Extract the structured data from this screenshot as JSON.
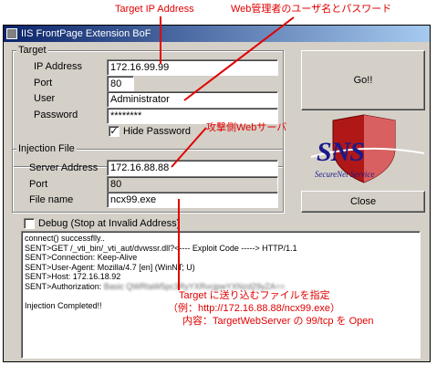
{
  "window": {
    "title": "IIS FrontPage Extension BoF"
  },
  "target_group": {
    "legend": "Target",
    "ip_label": "IP Address",
    "ip_value": "172.16.99.99",
    "port_label": "Port",
    "port_value": "80",
    "user_label": "User",
    "user_value": "Administrator",
    "password_label": "Password",
    "password_value": "********",
    "hide_password_label": "Hide Password",
    "hide_password_checked": "✓"
  },
  "injection_group": {
    "legend": "Injection File",
    "server_label": "Server Address",
    "server_value": "172.16.88.88",
    "port_label": "Port",
    "port_value": "80",
    "file_label": "File name",
    "file_value": "ncx99.exe"
  },
  "debug": {
    "label": "Debug (Stop at Invalid Address)"
  },
  "buttons": {
    "go": "Go!!",
    "close": "Close"
  },
  "logo": {
    "text": "SNS",
    "sub": "SecureNet Service"
  },
  "log": {
    "lines": [
      "connect() successflly..",
      "SENT>GET /_vti_bin/_vti_aut/dvwssr.dll?<---- Exploit Code -----> HTTP/1.1",
      "SENT>Connection: Keep-Alive",
      "SENT>User-Agent: Mozilla/4.7 [en] (WinNT; U)",
      "SENT>Host: 172.16.18.92",
      "SENT>Authorization:",
      "",
      "Injection Completed!!"
    ],
    "auth_blurred": "Basic QWRtaW5pc3RyYXRvcjpwYXNzd29yZA=="
  },
  "annotations": {
    "target_ip": "Target IP Address",
    "web_admin": "Web管理者のユーザ名とパスワード",
    "attack_server": "攻撃側Webサーバ",
    "file_line1": "Target に送り込むファイルを指定",
    "file_line2": "（例：http://172.16.88.88/ncx99.exe）",
    "file_line3": "内容：TargetWebServer の 99/tcp を Open"
  },
  "colors": {
    "annotation": "#e00000",
    "titlebar": "#0a246a",
    "face": "#d4d0c8"
  }
}
